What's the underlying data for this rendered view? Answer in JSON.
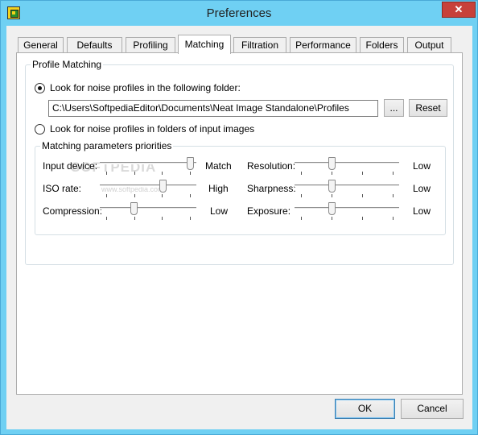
{
  "window": {
    "title": "Preferences",
    "close_label": "✕"
  },
  "tabs": [
    {
      "label": "General",
      "active": false
    },
    {
      "label": "Defaults",
      "active": false
    },
    {
      "label": "Profiling",
      "active": false
    },
    {
      "label": "Matching",
      "active": true
    },
    {
      "label": "Filtration",
      "active": false
    },
    {
      "label": "Performance",
      "active": false
    },
    {
      "label": "Folders",
      "active": false
    },
    {
      "label": "Output",
      "active": false
    }
  ],
  "profile_matching": {
    "group_label": "Profile Matching",
    "radio_folder": {
      "label": "Look for noise profiles in the following folder:",
      "checked": true
    },
    "folder_path": "C:\\Users\\SoftpediaEditor\\Documents\\Neat Image Standalone\\Profiles",
    "browse_label": "...",
    "reset_label": "Reset",
    "radio_input_folders": {
      "label": "Look for noise profiles in folders of input images",
      "checked": false
    }
  },
  "priorities": {
    "group_label": "Matching parameters priorities",
    "left": [
      {
        "label": "Input device:",
        "value_label": "Match",
        "level": 1.0
      },
      {
        "label": "ISO rate:",
        "value_label": "High",
        "level": 0.67
      },
      {
        "label": "Compression:",
        "value_label": "Low",
        "level": 0.33
      }
    ],
    "right": [
      {
        "label": "Resolution:",
        "value_label": "Low",
        "level": 0.33
      },
      {
        "label": "Sharpness:",
        "value_label": "Low",
        "level": 0.33
      },
      {
        "label": "Exposure:",
        "value_label": "Low",
        "level": 0.33
      }
    ]
  },
  "footer": {
    "ok_label": "OK",
    "cancel_label": "Cancel"
  },
  "watermark": {
    "main": "SOFTPEDIA",
    "url": "www.softpedia.com"
  }
}
